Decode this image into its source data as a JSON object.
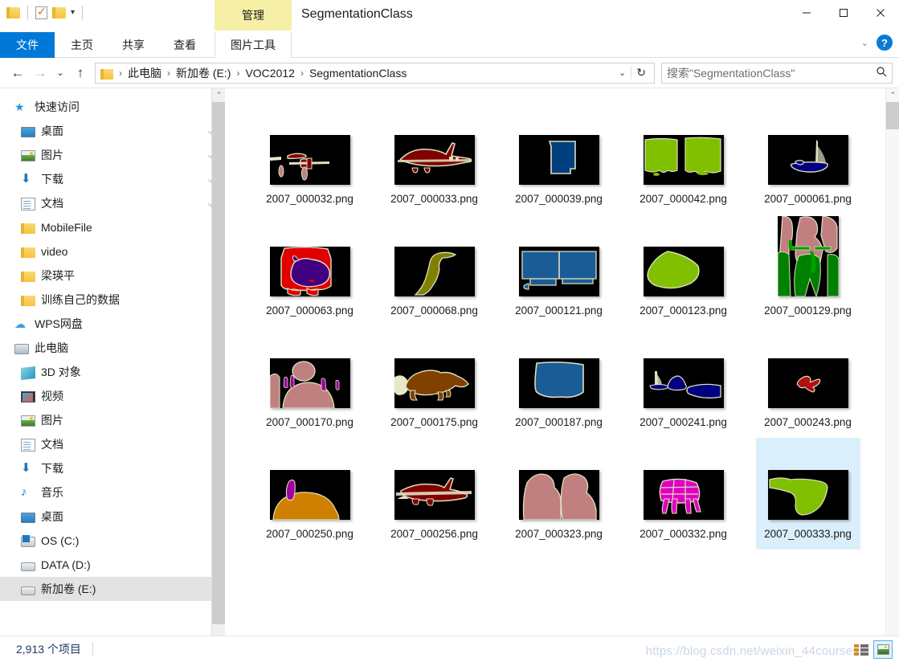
{
  "window": {
    "title": "SegmentationClass",
    "quick_access_toolbar": [
      {
        "name": "folder-icon",
        "label": ""
      },
      {
        "name": "properties-icon",
        "label": ""
      },
      {
        "name": "new-folder-icon",
        "label": ""
      },
      {
        "name": "customize-caret",
        "label": "▾"
      }
    ],
    "controls": {
      "minimize": "—",
      "maximize": "▢",
      "close": "✕"
    },
    "ribbon_collapse": "⌄",
    "help": "?"
  },
  "ribbon": {
    "contextual_tab_group": "管理",
    "contextual_tab": "图片工具",
    "tabs": [
      {
        "label": "文件",
        "active": true
      },
      {
        "label": "主页",
        "active": false
      },
      {
        "label": "共享",
        "active": false
      },
      {
        "label": "查看",
        "active": false
      }
    ]
  },
  "navigation": {
    "back": "←",
    "forward": "→",
    "recent": "⌄",
    "up": "↑",
    "breadcrumb": [
      "此电脑",
      "新加卷 (E:)",
      "VOC2012",
      "SegmentationClass"
    ],
    "breadcrumb_caret": "⌄",
    "refresh": "↻"
  },
  "search": {
    "placeholder": "搜索\"SegmentationClass\"",
    "icon": "search-icon"
  },
  "sidebar": {
    "items": [
      {
        "label": "快速访问",
        "icon": "star-icon",
        "level": 0,
        "pinned": false,
        "selected": false
      },
      {
        "label": "桌面",
        "icon": "desktop-icon",
        "level": 1,
        "pinned": true,
        "selected": false
      },
      {
        "label": "图片",
        "icon": "pictures-icon",
        "level": 1,
        "pinned": true,
        "selected": false
      },
      {
        "label": "下载",
        "icon": "downloads-icon",
        "level": 1,
        "pinned": true,
        "selected": false
      },
      {
        "label": "文档",
        "icon": "documents-icon",
        "level": 1,
        "pinned": true,
        "selected": false
      },
      {
        "label": "MobileFile",
        "icon": "folder-icon",
        "level": 1,
        "pinned": false,
        "selected": false
      },
      {
        "label": "video",
        "icon": "folder-icon",
        "level": 1,
        "pinned": false,
        "selected": false
      },
      {
        "label": "梁瑛平",
        "icon": "folder-icon",
        "level": 1,
        "pinned": false,
        "selected": false
      },
      {
        "label": "训练自己的数据",
        "icon": "folder-icon",
        "level": 1,
        "pinned": false,
        "selected": false
      },
      {
        "label": "WPS网盘",
        "icon": "cloud-icon",
        "level": 0,
        "pinned": false,
        "selected": false
      },
      {
        "label": "此电脑",
        "icon": "this-pc-icon",
        "level": 0,
        "pinned": false,
        "selected": false
      },
      {
        "label": "3D 对象",
        "icon": "3d-objects-icon",
        "level": 1,
        "pinned": false,
        "selected": false
      },
      {
        "label": "视频",
        "icon": "videos-icon",
        "level": 1,
        "pinned": false,
        "selected": false
      },
      {
        "label": "图片",
        "icon": "pictures-icon",
        "level": 1,
        "pinned": false,
        "selected": false
      },
      {
        "label": "文档",
        "icon": "documents-icon",
        "level": 1,
        "pinned": false,
        "selected": false
      },
      {
        "label": "下载",
        "icon": "downloads-icon",
        "level": 1,
        "pinned": false,
        "selected": false
      },
      {
        "label": "音乐",
        "icon": "music-icon",
        "level": 1,
        "pinned": false,
        "selected": false
      },
      {
        "label": "桌面",
        "icon": "desktop-icon",
        "level": 1,
        "pinned": false,
        "selected": false
      },
      {
        "label": "OS (C:)",
        "icon": "os-drive-icon",
        "level": 1,
        "pinned": false,
        "selected": false
      },
      {
        "label": "DATA (D:)",
        "icon": "drive-icon",
        "level": 1,
        "pinned": false,
        "selected": false
      },
      {
        "label": "新加卷 (E:)",
        "icon": "drive-icon",
        "level": 1,
        "pinned": false,
        "selected": true
      }
    ],
    "scroll_up": "⌃",
    "scroll_down": "⌄"
  },
  "files": [
    {
      "name": "2007_000032.png",
      "selected": false,
      "portrait": false
    },
    {
      "name": "2007_000033.png",
      "selected": false,
      "portrait": false
    },
    {
      "name": "2007_000039.png",
      "selected": false,
      "portrait": false
    },
    {
      "name": "2007_000042.png",
      "selected": false,
      "portrait": false
    },
    {
      "name": "2007_000061.png",
      "selected": false,
      "portrait": false
    },
    {
      "name": "2007_000063.png",
      "selected": false,
      "portrait": false
    },
    {
      "name": "2007_000068.png",
      "selected": false,
      "portrait": false
    },
    {
      "name": "2007_000121.png",
      "selected": false,
      "portrait": false
    },
    {
      "name": "2007_000123.png",
      "selected": false,
      "portrait": false
    },
    {
      "name": "2007_000129.png",
      "selected": false,
      "portrait": true
    },
    {
      "name": "2007_000170.png",
      "selected": false,
      "portrait": false
    },
    {
      "name": "2007_000175.png",
      "selected": false,
      "portrait": false
    },
    {
      "name": "2007_000187.png",
      "selected": false,
      "portrait": false
    },
    {
      "name": "2007_000241.png",
      "selected": false,
      "portrait": false
    },
    {
      "name": "2007_000243.png",
      "selected": false,
      "portrait": false
    },
    {
      "name": "2007_000250.png",
      "selected": false,
      "portrait": false
    },
    {
      "name": "2007_000256.png",
      "selected": false,
      "portrait": false
    },
    {
      "name": "2007_000323.png",
      "selected": false,
      "portrait": false
    },
    {
      "name": "2007_000332.png",
      "selected": false,
      "portrait": false
    },
    {
      "name": "2007_000333.png",
      "selected": true,
      "portrait": false
    }
  ],
  "statusbar": {
    "item_count": "2,913 个项目",
    "watermark": "https://blog.csdn.net/weixin_44courses",
    "view_details": "details-view",
    "view_large_icons": "large-icons-view"
  },
  "colors": {
    "accent": "#0078d7",
    "contextual_tab": "#f5f0a6",
    "selection": "#dbeefb",
    "sidebar_selection": "#e3e3e3",
    "voc_background": "#000000",
    "voc_aeroplane": "#800000",
    "voc_person": "#c08080",
    "voc_sofa": "#004080",
    "voc_pottedplant": "#80c000",
    "voc_boat": "#000080",
    "voc_dog": "#804000",
    "voc_bird": "#808000",
    "voc_cat": "#400080",
    "voc_bottle": "#a000a0",
    "voc_diningtable": "#d08000",
    "voc_horse": "#e000c0",
    "voc_bicycle": "#008000",
    "voc_outline": "#e0e0c0"
  }
}
